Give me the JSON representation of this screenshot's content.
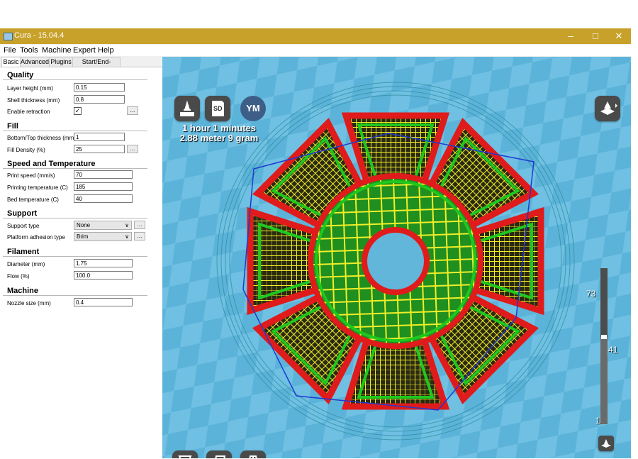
{
  "window": {
    "title": "Cura - 15.04.4",
    "minimize": "–",
    "maximize": "□",
    "close": "✕"
  },
  "menu": [
    "File",
    "Tools",
    "Machine",
    "Expert",
    "Help"
  ],
  "tabs": [
    "Basic",
    "Advanced",
    "Plugins",
    "Start/End-GCode"
  ],
  "sections": {
    "quality": {
      "title": "Quality",
      "layer_height_label": "Layer height (mm)",
      "layer_height": "0.15",
      "shell_label": "Shell thickness (mm)",
      "shell": "0.8",
      "retraction_label": "Enable retraction",
      "retraction_checked": "✓"
    },
    "fill": {
      "title": "Fill",
      "bottom_top_label": "Bottom/Top thickness (mm)",
      "bottom_top": "1",
      "density_label": "Fill Density (%)",
      "density": "25"
    },
    "speed": {
      "title": "Speed and Temperature",
      "print_speed_label": "Print speed (mm/s)",
      "print_speed": "70",
      "print_temp_label": "Printing temperature (C)",
      "print_temp": "185",
      "bed_temp_label": "Bed temperature (C)",
      "bed_temp": "40"
    },
    "support": {
      "title": "Support",
      "type_label": "Support type",
      "type": "None",
      "adhesion_label": "Platform adhesion type",
      "adhesion": "Brim"
    },
    "filament": {
      "title": "Filament",
      "diameter_label": "Diameter (mm)",
      "diameter": "1.75",
      "flow_label": "Flow (%)",
      "flow": "100.0"
    },
    "machine": {
      "title": "Machine",
      "nozzle_label": "Nozzle size (mm)",
      "nozzle": "0.4"
    }
  },
  "dots_label": "...",
  "chevron": "∨",
  "viewport": {
    "print_time": "1 hour 1 minutes",
    "print_material": "2.88 meter 9 gram",
    "ym_label": "YM",
    "sd_label": "SD",
    "layer_max": "73",
    "layer_current": "41",
    "layer_min": "1",
    "layer_fraction": 0.56
  },
  "colors": {
    "titlebar": "#c8a12a",
    "viewport_bg": "#5fb4d8",
    "shell": "#e01b1b",
    "inner_wall": "#1ec81e",
    "infill": "#f2ee29",
    "travel": "#1f3ad1"
  }
}
